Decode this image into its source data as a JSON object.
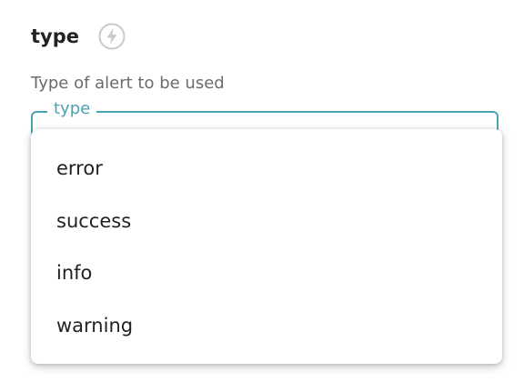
{
  "property": {
    "name": "type",
    "icon": "lightning-bolt-icon",
    "description": "Type of alert to be used"
  },
  "select": {
    "label": "type",
    "accent_color": "#4aa3b2",
    "options": [
      "error",
      "success",
      "info",
      "warning"
    ]
  }
}
